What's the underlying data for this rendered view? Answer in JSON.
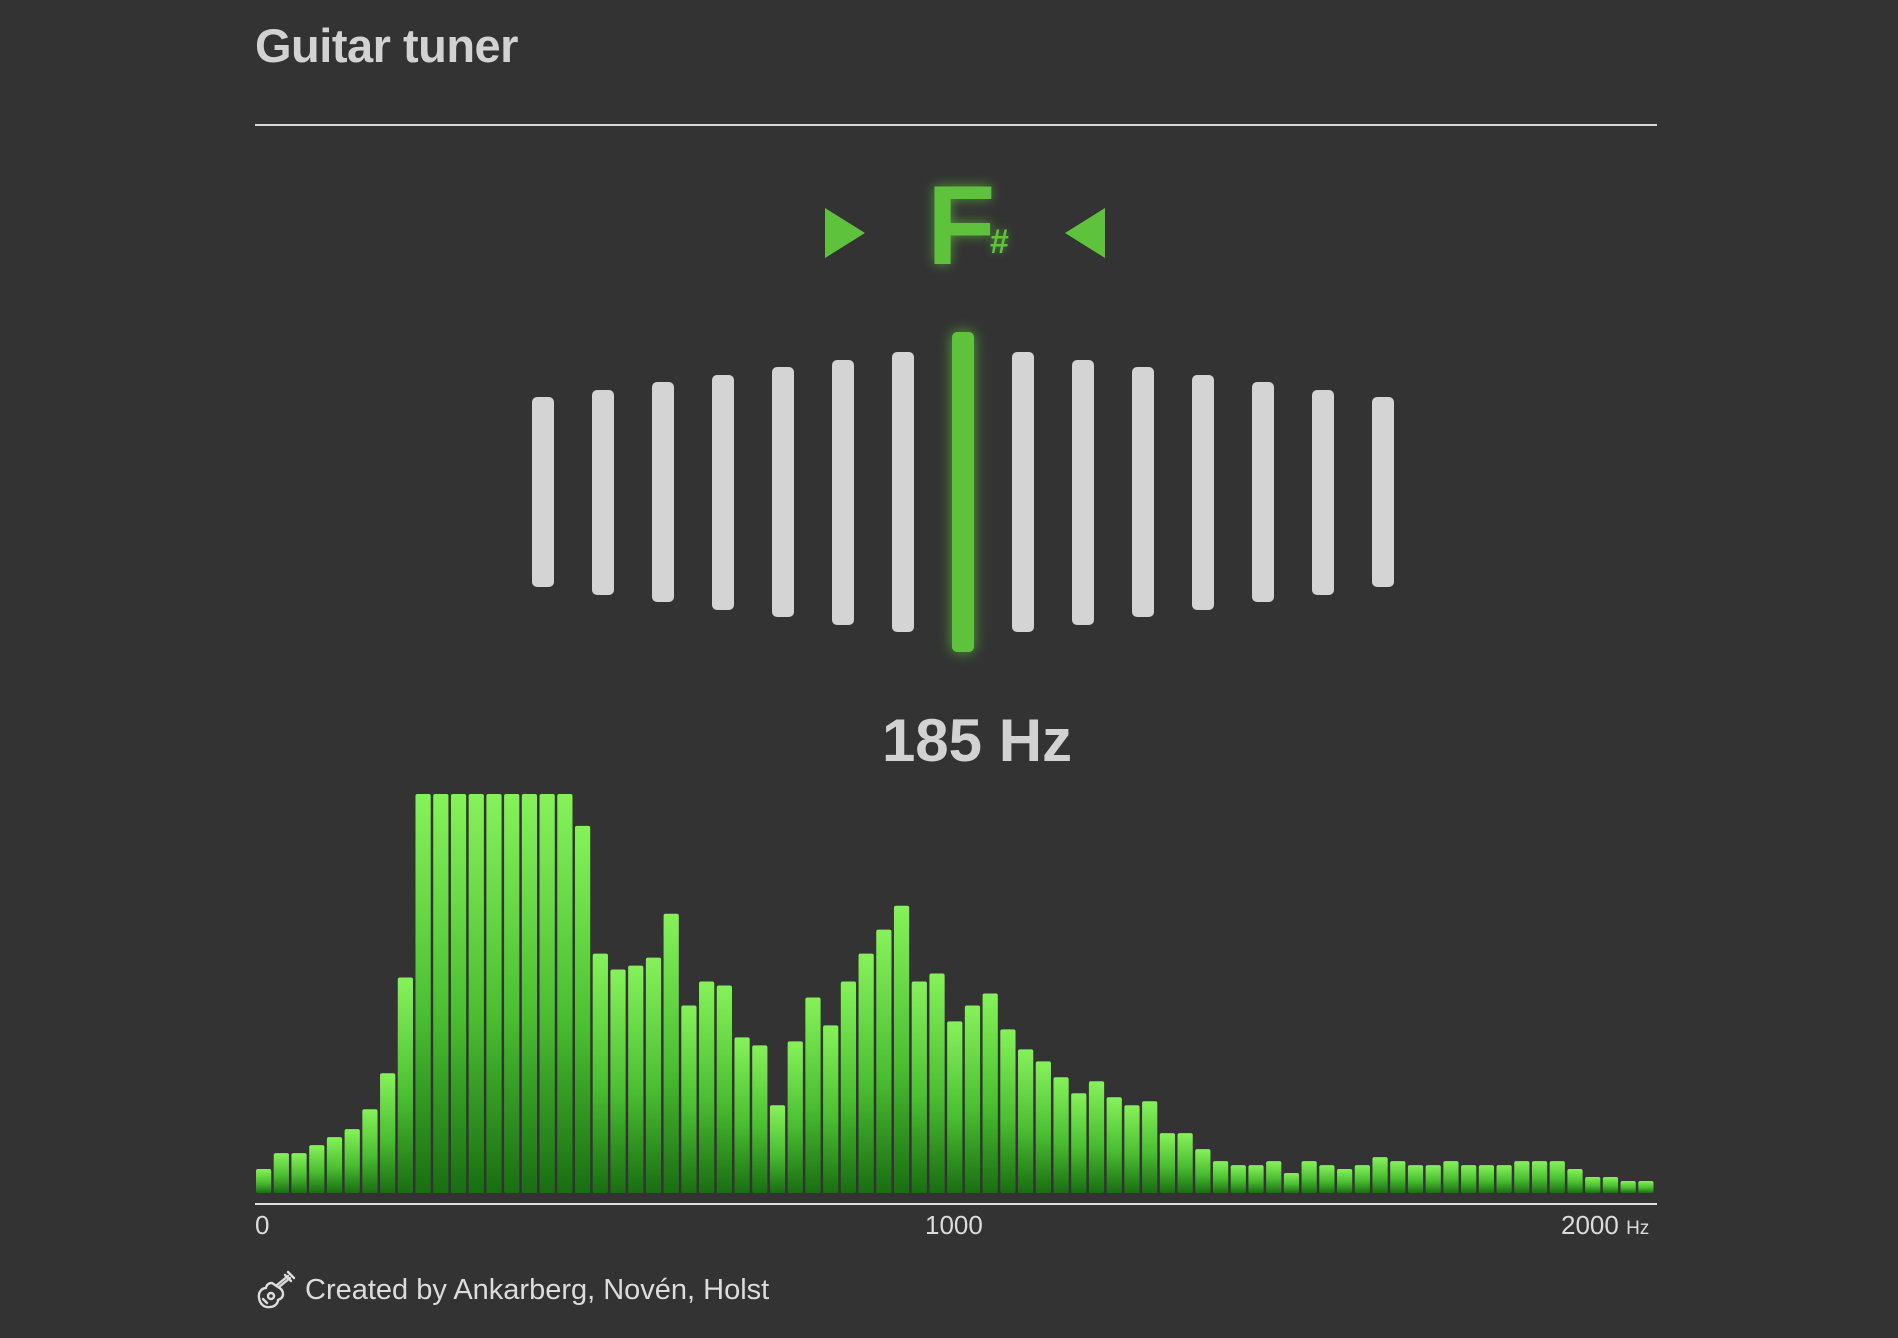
{
  "header": {
    "title": "Guitar tuner"
  },
  "tuner": {
    "note": "F",
    "accidental": "#",
    "frequency_label": "185 Hz",
    "meter_levels": 15,
    "active_index": 7,
    "accent_color": "#5ec23c",
    "inactive_color": "#d4d4d4"
  },
  "axis": {
    "tick_0": "0",
    "tick_1000": "1000",
    "tick_2000": "2000",
    "unit": "Hz"
  },
  "footer": {
    "icon": "guitar-icon",
    "credit": "Created by Ankarberg, Novén, Holst"
  },
  "chart_data": {
    "type": "bar",
    "xlabel": "Hz",
    "xlim": [
      0,
      2000
    ],
    "ylim": [
      0,
      100
    ],
    "grid": false,
    "bin_width_hz": 25,
    "values": [
      6,
      10,
      10,
      12,
      14,
      16,
      21,
      30,
      54,
      100,
      100,
      100,
      100,
      100,
      100,
      100,
      100,
      100,
      92,
      60,
      56,
      57,
      59,
      70,
      47,
      53,
      52,
      39,
      37,
      22,
      38,
      49,
      42,
      53,
      60,
      66,
      72,
      53,
      55,
      43,
      47,
      50,
      41,
      36,
      33,
      29,
      25,
      28,
      24,
      22,
      23,
      15,
      15,
      11,
      8,
      7,
      7,
      8,
      5,
      8,
      7,
      6,
      7,
      9,
      8,
      7,
      7,
      8,
      7,
      7,
      7,
      8,
      8,
      8,
      6,
      4,
      4,
      3,
      3
    ]
  }
}
